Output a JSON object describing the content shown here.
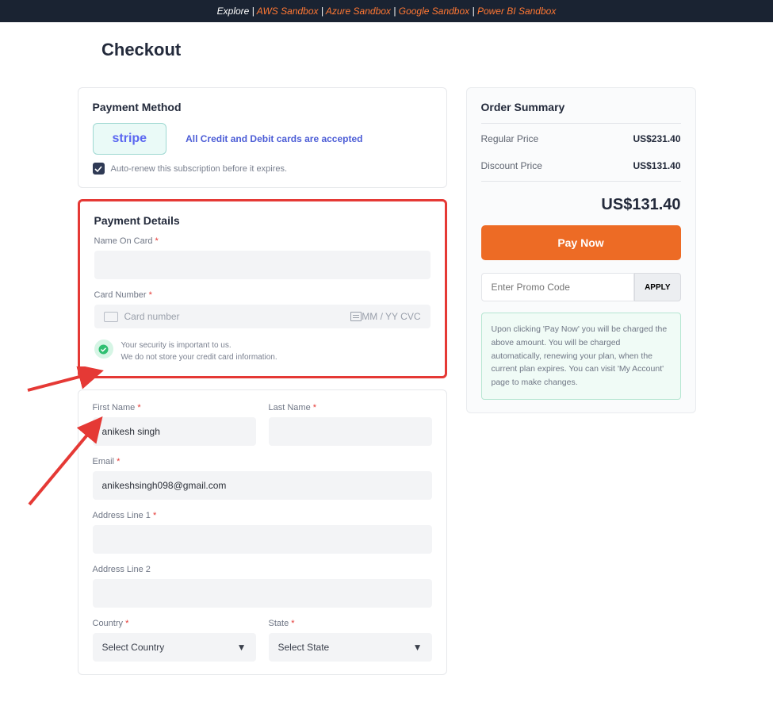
{
  "topbar": {
    "explore": "Explore",
    "aws": "AWS Sandbox",
    "azure": "Azure Sandbox",
    "google": "Google Sandbox",
    "powerbi": "Power BI Sandbox"
  },
  "title": "Checkout",
  "payment_method": {
    "heading": "Payment Method",
    "stripe": "stripe",
    "credit_text": "All Credit and Debit cards are accepted",
    "autorenew": "Auto-renew this subscription before it expires."
  },
  "payment_details": {
    "heading": "Payment Details",
    "name_label": "Name On Card",
    "card_label": "Card Number",
    "card_placeholder": "Card number",
    "card_tail": "MM / YY  CVC",
    "sec1": "Your security is important to us.",
    "sec2": "We do not store your credit card information."
  },
  "personal": {
    "fname_label": "First Name",
    "fname_value": "anikesh singh",
    "lname_label": "Last Name",
    "lname_value": "",
    "email_label": "Email",
    "email_value": "anikeshsingh098@gmail.com",
    "addr1_label": "Address Line 1",
    "addr1_value": "",
    "addr2_label": "Address Line 2",
    "addr2_value": "",
    "country_label": "Country",
    "country_value": "Select Country",
    "state_label": "State",
    "state_value": "Select State"
  },
  "summary": {
    "heading": "Order Summary",
    "regular_label": "Regular Price",
    "regular_value": "US$231.40",
    "discount_label": "Discount Price",
    "discount_value": "US$131.40",
    "total": "US$131.40",
    "pay": "Pay Now",
    "promo_placeholder": "Enter Promo Code",
    "apply": "APPLY",
    "note": "Upon clicking 'Pay Now' you will be charged the above amount. You will be charged automatically, renewing your plan, when the current plan expires. You can visit 'My Account' page to make changes."
  }
}
